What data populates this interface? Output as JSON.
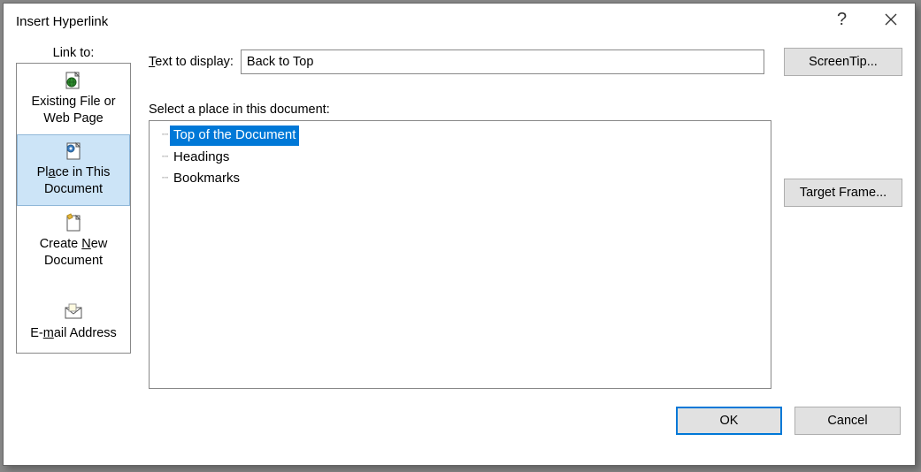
{
  "dialog": {
    "title": "Insert Hyperlink"
  },
  "sidebar": {
    "label": "Link to:",
    "items": [
      {
        "label_line1": "Existing File or",
        "label_line2": "Web Page",
        "selected": false
      },
      {
        "label_line1": "Place in This",
        "label_line2": "Document",
        "selected": true
      },
      {
        "label_line1": "Create New",
        "label_line2": "Document",
        "selected": false
      },
      {
        "label_line1": "E-mail Address",
        "label_line2": "",
        "selected": false
      }
    ]
  },
  "text_to_display": {
    "label_pre": "T",
    "label_post": "ext to display:",
    "value": "Back to Top"
  },
  "screentip": {
    "label": "ScreenTip..."
  },
  "tree": {
    "label": "Select a place in this document:",
    "items": [
      {
        "text": "Top of the Document",
        "selected": true
      },
      {
        "text": "Headings",
        "selected": false
      },
      {
        "text": "Bookmarks",
        "selected": false
      }
    ]
  },
  "target_frame": {
    "label": "Target Frame..."
  },
  "footer": {
    "ok": "OK",
    "cancel": "Cancel"
  }
}
